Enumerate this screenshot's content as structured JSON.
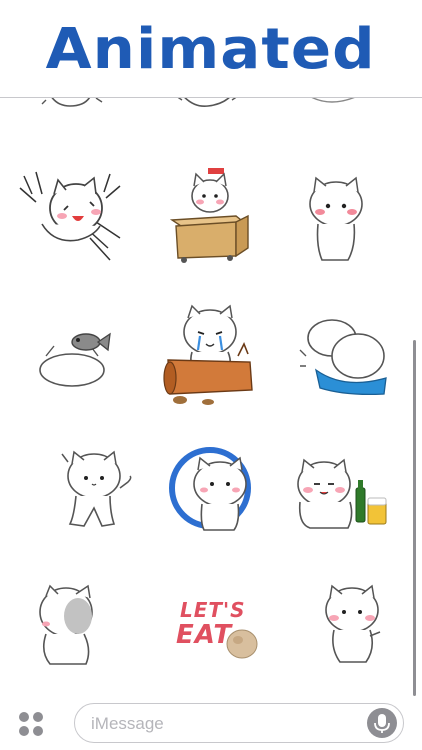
{
  "banner": {
    "title": "Animated",
    "color": "#1f5bb5"
  },
  "stickers": [
    {
      "name": "cat-stretching-partial"
    },
    {
      "name": "cat-lying-partial"
    },
    {
      "name": "cat-sitting-partial"
    },
    {
      "name": "cat-rolling-laughing"
    },
    {
      "name": "cat-in-cardboard-box"
    },
    {
      "name": "cat-shy-standing"
    },
    {
      "name": "cat-lying-with-fish"
    },
    {
      "name": "cat-crying-on-log"
    },
    {
      "name": "cat-on-blue-blanket"
    },
    {
      "name": "cat-waving"
    },
    {
      "name": "cat-in-blue-ring"
    },
    {
      "name": "cat-with-beer"
    },
    {
      "name": "cat-turning-away"
    },
    {
      "name": "lets-eat-sticker",
      "text_line1": "LET'S",
      "text_line2": "EAT"
    },
    {
      "name": "cat-pointing"
    }
  ],
  "message_bar": {
    "placeholder": "iMessage",
    "apps_icon": "app-grid-icon",
    "mic_icon": "microphone-icon"
  }
}
